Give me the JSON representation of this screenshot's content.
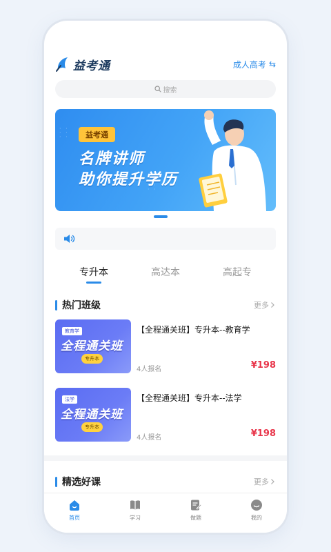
{
  "header": {
    "logo_text": "益考通",
    "exam_type": "成人高考",
    "swap_icon": "⇆"
  },
  "search": {
    "placeholder": "搜索"
  },
  "banner": {
    "tag": "益考通",
    "line1": "名牌讲师",
    "line2": "助你提升学历"
  },
  "tabs": [
    {
      "label": "专升本",
      "active": true
    },
    {
      "label": "高达本",
      "active": false
    },
    {
      "label": "高起专",
      "active": false
    }
  ],
  "hot_section": {
    "title": "热门班级",
    "more": "更多"
  },
  "courses": [
    {
      "subject_tag": "教育学",
      "thumb_title": "全程通关班",
      "level_tag": "专升本",
      "title": "【全程通关班】专升本--教育学",
      "count": "4人报名",
      "price": "¥198"
    },
    {
      "subject_tag": "法学",
      "thumb_title": "全程通关班",
      "level_tag": "专升本",
      "title": "【全程通关班】专升本--法学",
      "count": "4人报名",
      "price": "¥198"
    }
  ],
  "picked_section": {
    "title": "精选好课",
    "more": "更多"
  },
  "bottom_nav": [
    {
      "label": "首页",
      "icon": "home-icon",
      "active": true
    },
    {
      "label": "学习",
      "icon": "book-icon",
      "active": false
    },
    {
      "label": "做题",
      "icon": "edit-icon",
      "active": false
    },
    {
      "label": "我的",
      "icon": "profile-icon",
      "active": false
    }
  ],
  "colors": {
    "accent": "#2a8be8",
    "price": "#e8354a",
    "banner_tag": "#ffc43a"
  }
}
